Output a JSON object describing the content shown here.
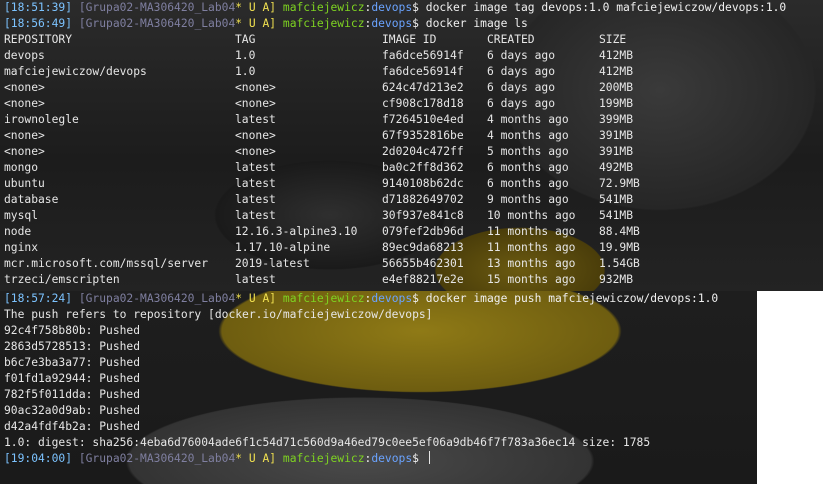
{
  "prompt1": {
    "time": "[18:51:39]",
    "tag": "[Grupa02-MA306420_Lab04",
    "flags": "* U A]",
    "user": "mafciejewicz",
    "sep": ":",
    "path": "devops",
    "dollar": "$",
    "command": "docker image tag devops:1.0 mafciejewiczow/devops:1.0"
  },
  "prompt2": {
    "time": "[18:56:49]",
    "tag": "[Grupa02-MA306420_Lab04",
    "flags": "* U A]",
    "user": "mafciejewicz",
    "sep": ":",
    "path": "devops",
    "dollar": "$",
    "command": "docker image ls"
  },
  "table": {
    "headers": [
      "REPOSITORY",
      "TAG",
      "IMAGE ID",
      "CREATED",
      "SIZE"
    ],
    "rows": [
      [
        "devops",
        "1.0",
        "fa6dce56914f",
        "6 days ago",
        "412MB"
      ],
      [
        "mafciejewiczow/devops",
        "1.0",
        "fa6dce56914f",
        "6 days ago",
        "412MB"
      ],
      [
        "<none>",
        "<none>",
        "624c47d213e2",
        "6 days ago",
        "200MB"
      ],
      [
        "<none>",
        "<none>",
        "cf908c178d18",
        "6 days ago",
        "199MB"
      ],
      [
        "irownolegle",
        "latest",
        "f7264510e4ed",
        "4 months ago",
        "399MB"
      ],
      [
        "<none>",
        "<none>",
        "67f9352816be",
        "4 months ago",
        "391MB"
      ],
      [
        "<none>",
        "<none>",
        "2d0204c472ff",
        "5 months ago",
        "391MB"
      ],
      [
        "mongo",
        "latest",
        "ba0c2ff8d362",
        "6 months ago",
        "492MB"
      ],
      [
        "ubuntu",
        "latest",
        "9140108b62dc",
        "6 months ago",
        "72.9MB"
      ],
      [
        "database",
        "latest",
        "d71882649702",
        "9 months ago",
        "541MB"
      ],
      [
        "mysql",
        "latest",
        "30f937e841c8",
        "10 months ago",
        "541MB"
      ],
      [
        "node",
        "12.16.3-alpine3.10",
        "079fef2db96d",
        "11 months ago",
        "88.4MB"
      ],
      [
        "nginx",
        "1.17.10-alpine",
        "89ec9da68213",
        "11 months ago",
        "19.9MB"
      ],
      [
        "mcr.microsoft.com/mssql/server",
        "2019-latest",
        "56655b462301",
        "13 months ago",
        "1.54GB"
      ],
      [
        "trzeci/emscripten",
        "latest",
        "e4ef88217e2e",
        "15 months ago",
        "932MB"
      ]
    ]
  },
  "prompt3": {
    "time": "[18:57:24]",
    "tag": "[Grupa02-MA306420_Lab04",
    "flags": "* U A]",
    "user": "mafciejewicz",
    "sep": ":",
    "path": "devops",
    "dollar": "$",
    "command": "docker image push mafciejewiczow/devops:1.0"
  },
  "push_output": [
    "The push refers to repository [docker.io/mafciejewiczow/devops]",
    "92c4f758b80b: Pushed",
    "2863d5728513: Pushed",
    "b6c7e3ba3a77: Pushed",
    "f01fd1a92944: Pushed",
    "782f5f011dda: Pushed",
    "90ac32a0d9ab: Pushed",
    "d42a4fdf4b2a: Pushed",
    "1.0: digest: sha256:4eba6d76004ade6f1c54d71c560d9a46ed79c0ee5ef06a9db46f7f783a36ec14 size: 1785"
  ],
  "prompt4": {
    "time": "[19:04:00]",
    "tag": "[Grupa02-MA306420_Lab04",
    "flags": "* U A]",
    "user": "mafciejewicz",
    "sep": ":",
    "path": "devops",
    "dollar": "$",
    "command": ""
  },
  "colors": {
    "timestamp": "#7cc3ff",
    "user": "#7ed321",
    "path": "#6aa3ff",
    "flags": "#f0e050"
  }
}
